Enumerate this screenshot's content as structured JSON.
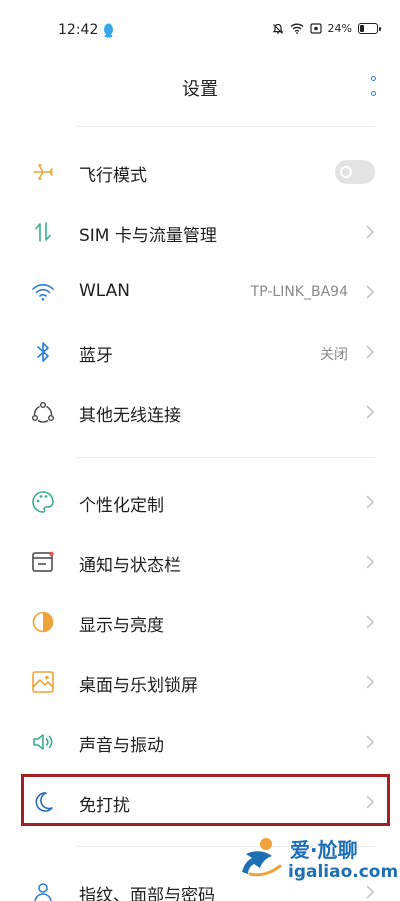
{
  "status_bar": {
    "time": "12:42",
    "battery": "24%",
    "battery_level": 0.24
  },
  "header": {
    "title": "设置"
  },
  "section1": [
    {
      "label": "飞行模式",
      "icon": "airplane-icon",
      "control": "toggle",
      "toggle_on": false
    },
    {
      "label": "SIM 卡与流量管理",
      "icon": "sim-data-icon"
    },
    {
      "label": "WLAN",
      "icon": "wifi-icon",
      "value": "TP-LINK_BA94"
    },
    {
      "label": "蓝牙",
      "icon": "bluetooth-icon",
      "value": "关闭"
    },
    {
      "label": "其他无线连接",
      "icon": "wireless-connections-icon"
    }
  ],
  "section2": [
    {
      "label": "个性化定制",
      "icon": "palette-icon"
    },
    {
      "label": "通知与状态栏",
      "icon": "notification-icon"
    },
    {
      "label": "显示与亮度",
      "icon": "brightness-icon"
    },
    {
      "label": "桌面与乐划锁屏",
      "icon": "wallpaper-icon"
    },
    {
      "label": "声音与振动",
      "icon": "speaker-icon"
    },
    {
      "label": "免打扰",
      "icon": "moon-icon",
      "highlighted": true
    }
  ],
  "section3": [
    {
      "label": "指纹、面部与密码",
      "icon": "fingerprint-icon"
    }
  ],
  "watermark": {
    "line1": "爱·尬聊",
    "line2": "igaliao.com"
  },
  "colors": {
    "accent_blue": "#2a7fd4",
    "orange": "#f0a23a",
    "green": "#3ab08f",
    "highlight_border": "#a31f22"
  }
}
